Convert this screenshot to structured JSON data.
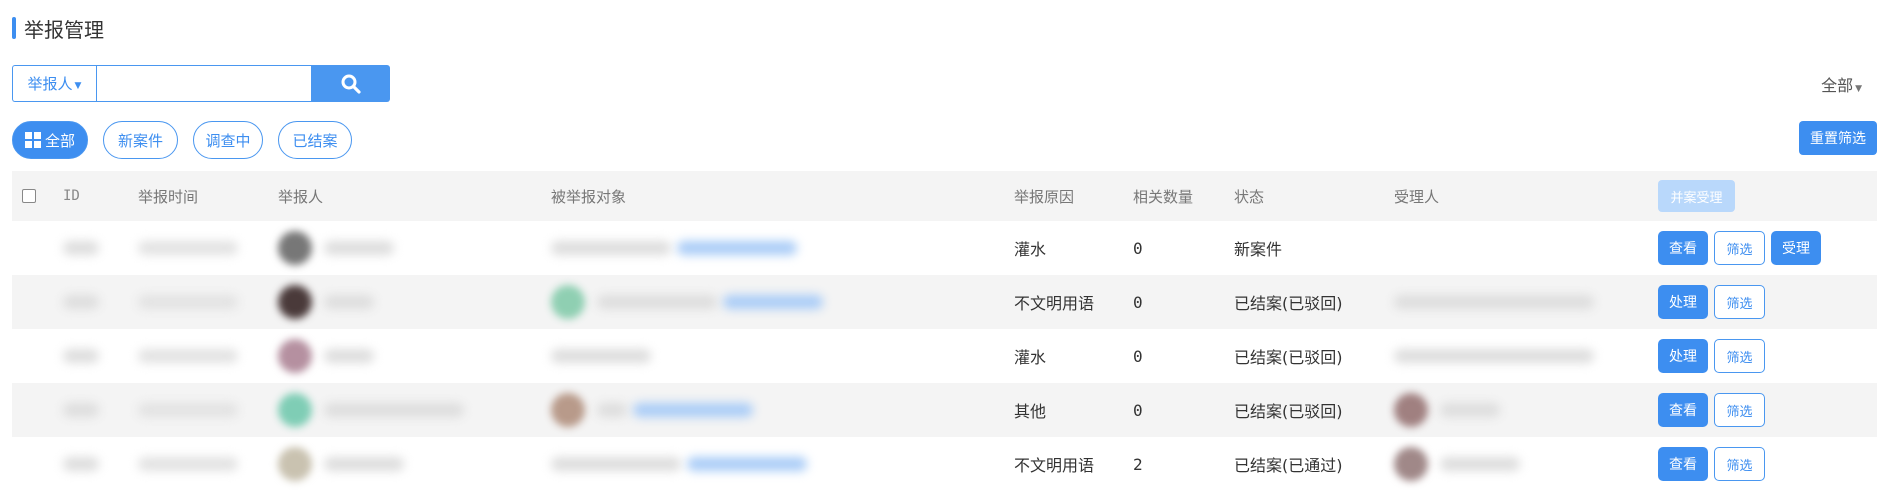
{
  "page": {
    "title": "举报管理"
  },
  "search": {
    "field_label": "举报人",
    "query": ""
  },
  "scope_select": "全部",
  "filters": [
    {
      "label": "全部",
      "active": true
    },
    {
      "label": "新案件",
      "active": false
    },
    {
      "label": "调查中",
      "active": false
    },
    {
      "label": "已结案",
      "active": false
    }
  ],
  "reset_label": "重置筛选",
  "table": {
    "columns": {
      "id": "ID",
      "time": "举报时间",
      "reporter": "举报人",
      "target": "被举报对象",
      "reason": "举报原因",
      "count": "相关数量",
      "status": "状态",
      "handler": "受理人"
    },
    "batch_label": "并案受理",
    "rows": [
      {
        "reason": "灌水",
        "count": "0",
        "status": "新案件",
        "actions": [
          "查看",
          "筛选",
          "受理"
        ]
      },
      {
        "reason": "不文明用语",
        "count": "0",
        "status": "已结案(已驳回)",
        "actions": [
          "处理",
          "筛选"
        ]
      },
      {
        "reason": "灌水",
        "count": "0",
        "status": "已结案(已驳回)",
        "actions": [
          "处理",
          "筛选"
        ]
      },
      {
        "reason": "其他",
        "count": "0",
        "status": "已结案(已驳回)",
        "actions": [
          "查看",
          "筛选"
        ]
      },
      {
        "reason": "不文明用语",
        "count": "2",
        "status": "已结案(已通过)",
        "actions": [
          "查看",
          "筛选"
        ]
      }
    ]
  },
  "colors": {
    "primary": "#3d8ef0",
    "header_bg": "#f4f4f4",
    "disabled": "#b9d8fb"
  }
}
